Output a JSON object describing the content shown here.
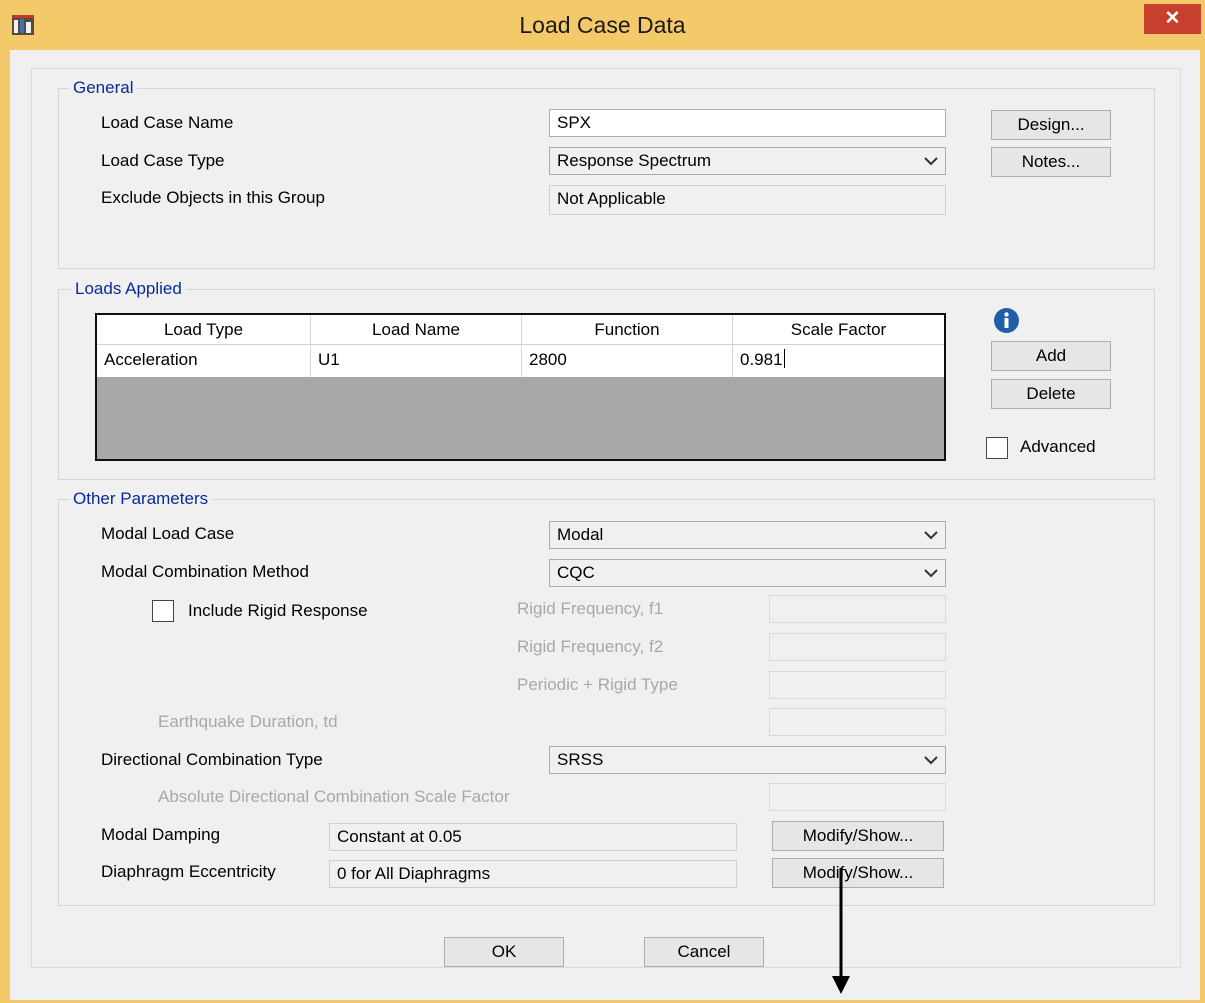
{
  "window": {
    "title": "Load Case Data",
    "close_glyph": "✕"
  },
  "general": {
    "title": "General",
    "load_case_name_label": "Load Case Name",
    "load_case_name_value": "SPX",
    "load_case_type_label": "Load Case Type",
    "load_case_type_value": "Response Spectrum",
    "exclude_label": "Exclude Objects in this Group",
    "exclude_value": "Not Applicable",
    "design_button": "Design...",
    "notes_button": "Notes..."
  },
  "loads_applied": {
    "title": "Loads Applied",
    "columns": [
      "Load Type",
      "Load Name",
      "Function",
      "Scale Factor"
    ],
    "rows": [
      [
        "Acceleration",
        "U1",
        "2800",
        "0.981"
      ]
    ],
    "add_button": "Add",
    "delete_button": "Delete",
    "advanced_label": "Advanced",
    "advanced_checked": false
  },
  "other": {
    "title": "Other Parameters",
    "modal_load_case_label": "Modal Load Case",
    "modal_load_case_value": "Modal",
    "modal_combination_label": "Modal Combination Method",
    "modal_combination_value": "CQC",
    "include_rigid_label": "Include Rigid Response",
    "include_rigid_checked": false,
    "rigid_f1_label": "Rigid Frequency, f1",
    "rigid_f2_label": "Rigid Frequency, f2",
    "periodic_rigid_label": "Periodic + Rigid Type",
    "eq_duration_label": "Earthquake Duration, td",
    "directional_label": "Directional Combination Type",
    "directional_value": "SRSS",
    "abs_directional_label": "Absolute Directional Combination Scale Factor",
    "modal_damping_label": "Modal Damping",
    "modal_damping_value": "Constant at 0.05",
    "diaphragm_label": "Diaphragm Eccentricity",
    "diaphragm_value": "0 for All Diaphragms",
    "modify_show_button": "Modify/Show...",
    "modify_show_button_2": "Modify/Show..."
  },
  "footer": {
    "ok_button": "OK",
    "cancel_button": "Cancel"
  },
  "colors": {
    "title_bar": "#f4c96a",
    "close_button": "#c7402e",
    "group_title": "#0a2a9a",
    "dialog_bg": "#f0f0f0"
  }
}
